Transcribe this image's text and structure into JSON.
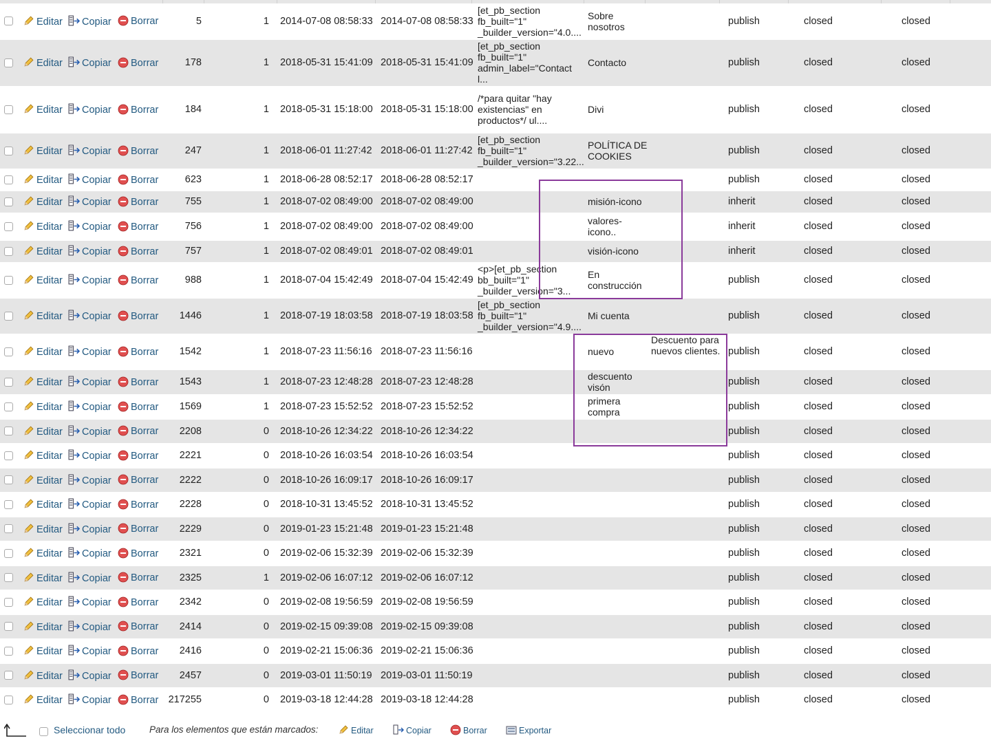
{
  "actions": {
    "edit": "Editar",
    "copy": "Copiar",
    "delete": "Borrar"
  },
  "rows": [
    {
      "id": "5",
      "author": "1",
      "date": "2014-07-08 08:58:33",
      "date_gmt": "2014-07-08 08:58:33",
      "content": "[et_pb_section fb_built=\"1\" _builder_version=\"4.0....",
      "title": "Sobre nosotros",
      "excerpt": "",
      "status": "publish",
      "comment_status": "closed",
      "ping_status": "closed"
    },
    {
      "id": "178",
      "author": "1",
      "date": "2018-05-31 15:41:09",
      "date_gmt": "2018-05-31 15:41:09",
      "content": "[et_pb_section fb_built=\"1\" admin_label=\"Contact l...",
      "title": "Contacto",
      "excerpt": "",
      "status": "publish",
      "comment_status": "closed",
      "ping_status": "closed"
    },
    {
      "id": "184",
      "author": "1",
      "date": "2018-05-31 15:18:00",
      "date_gmt": "2018-05-31 15:18:00",
      "content": "/*para quitar \"hay existencias\" en productos*/ ul....",
      "title": "Divi",
      "excerpt": "",
      "status": "publish",
      "comment_status": "closed",
      "ping_status": "closed"
    },
    {
      "id": "247",
      "author": "1",
      "date": "2018-06-01 11:27:42",
      "date_gmt": "2018-06-01 11:27:42",
      "content": "[et_pb_section fb_built=\"1\" _builder_version=\"3.22...",
      "title": "POLÍTICA DE COOKIES",
      "excerpt": "",
      "status": "publish",
      "comment_status": "closed",
      "ping_status": "closed"
    },
    {
      "id": "623",
      "author": "1",
      "date": "2018-06-28 08:52:17",
      "date_gmt": "2018-06-28 08:52:17",
      "content": "",
      "title": "",
      "excerpt": "",
      "status": "publish",
      "comment_status": "closed",
      "ping_status": "closed"
    },
    {
      "id": "755",
      "author": "1",
      "date": "2018-07-02 08:49:00",
      "date_gmt": "2018-07-02 08:49:00",
      "content": "",
      "title": "misión-icono",
      "excerpt": "",
      "status": "inherit",
      "comment_status": "closed",
      "ping_status": "closed"
    },
    {
      "id": "756",
      "author": "1",
      "date": "2018-07-02 08:49:00",
      "date_gmt": "2018-07-02 08:49:00",
      "content": "",
      "title": "valores-icono..",
      "excerpt": "",
      "status": "inherit",
      "comment_status": "closed",
      "ping_status": "closed"
    },
    {
      "id": "757",
      "author": "1",
      "date": "2018-07-02 08:49:01",
      "date_gmt": "2018-07-02 08:49:01",
      "content": "",
      "title": "visión-icono",
      "excerpt": "",
      "status": "inherit",
      "comment_status": "closed",
      "ping_status": "closed"
    },
    {
      "id": "988",
      "author": "1",
      "date": "2018-07-04 15:42:49",
      "date_gmt": "2018-07-04 15:42:49",
      "content": "<p>[et_pb_section bb_built=\"1\" _builder_version=\"3...",
      "title": "En construcción",
      "excerpt": "",
      "status": "publish",
      "comment_status": "closed",
      "ping_status": "closed"
    },
    {
      "id": "1446",
      "author": "1",
      "date": "2018-07-19 18:03:58",
      "date_gmt": "2018-07-19 18:03:58",
      "content": "[et_pb_section fb_built=\"1\" _builder_version=\"4.9....",
      "title": "Mi cuenta",
      "excerpt": "",
      "status": "publish",
      "comment_status": "closed",
      "ping_status": "closed"
    },
    {
      "id": "1542",
      "author": "1",
      "date": "2018-07-23 11:56:16",
      "date_gmt": "2018-07-23 11:56:16",
      "content": "",
      "title": "nuevo",
      "excerpt": "Descuento para nuevos clientes.",
      "status": "publish",
      "comment_status": "closed",
      "ping_status": "closed"
    },
    {
      "id": "1543",
      "author": "1",
      "date": "2018-07-23 12:48:28",
      "date_gmt": "2018-07-23 12:48:28",
      "content": "",
      "title": "descuento visón",
      "excerpt": "",
      "status": "publish",
      "comment_status": "closed",
      "ping_status": "closed"
    },
    {
      "id": "1569",
      "author": "1",
      "date": "2018-07-23 15:52:52",
      "date_gmt": "2018-07-23 15:52:52",
      "content": "",
      "title": "primera compra",
      "excerpt": "",
      "status": "publish",
      "comment_status": "closed",
      "ping_status": "closed"
    },
    {
      "id": "2208",
      "author": "0",
      "date": "2018-10-26 12:34:22",
      "date_gmt": "2018-10-26 12:34:22",
      "content": "",
      "title": "",
      "excerpt": "",
      "status": "publish",
      "comment_status": "closed",
      "ping_status": "closed"
    },
    {
      "id": "2221",
      "author": "0",
      "date": "2018-10-26 16:03:54",
      "date_gmt": "2018-10-26 16:03:54",
      "content": "",
      "title": "",
      "excerpt": "",
      "status": "publish",
      "comment_status": "closed",
      "ping_status": "closed"
    },
    {
      "id": "2222",
      "author": "0",
      "date": "2018-10-26 16:09:17",
      "date_gmt": "2018-10-26 16:09:17",
      "content": "",
      "title": "",
      "excerpt": "",
      "status": "publish",
      "comment_status": "closed",
      "ping_status": "closed"
    },
    {
      "id": "2228",
      "author": "0",
      "date": "2018-10-31 13:45:52",
      "date_gmt": "2018-10-31 13:45:52",
      "content": "",
      "title": "",
      "excerpt": "",
      "status": "publish",
      "comment_status": "closed",
      "ping_status": "closed"
    },
    {
      "id": "2229",
      "author": "0",
      "date": "2019-01-23 15:21:48",
      "date_gmt": "2019-01-23 15:21:48",
      "content": "",
      "title": "",
      "excerpt": "",
      "status": "publish",
      "comment_status": "closed",
      "ping_status": "closed"
    },
    {
      "id": "2321",
      "author": "0",
      "date": "2019-02-06 15:32:39",
      "date_gmt": "2019-02-06 15:32:39",
      "content": "",
      "title": "",
      "excerpt": "",
      "status": "publish",
      "comment_status": "closed",
      "ping_status": "closed"
    },
    {
      "id": "2325",
      "author": "1",
      "date": "2019-02-06 16:07:12",
      "date_gmt": "2019-02-06 16:07:12",
      "content": "",
      "title": "",
      "excerpt": "",
      "status": "publish",
      "comment_status": "closed",
      "ping_status": "closed"
    },
    {
      "id": "2342",
      "author": "0",
      "date": "2019-02-08 19:56:59",
      "date_gmt": "2019-02-08 19:56:59",
      "content": "",
      "title": "",
      "excerpt": "",
      "status": "publish",
      "comment_status": "closed",
      "ping_status": "closed"
    },
    {
      "id": "2414",
      "author": "0",
      "date": "2019-02-15 09:39:08",
      "date_gmt": "2019-02-15 09:39:08",
      "content": "",
      "title": "",
      "excerpt": "",
      "status": "publish",
      "comment_status": "closed",
      "ping_status": "closed"
    },
    {
      "id": "2416",
      "author": "0",
      "date": "2019-02-21 15:06:36",
      "date_gmt": "2019-02-21 15:06:36",
      "content": "",
      "title": "",
      "excerpt": "",
      "status": "publish",
      "comment_status": "closed",
      "ping_status": "closed"
    },
    {
      "id": "2457",
      "author": "0",
      "date": "2019-03-01 11:50:19",
      "date_gmt": "2019-03-01 11:50:19",
      "content": "",
      "title": "",
      "excerpt": "",
      "status": "publish",
      "comment_status": "closed",
      "ping_status": "closed"
    },
    {
      "id": "217255",
      "author": "0",
      "date": "2019-03-18 12:44:28",
      "date_gmt": "2019-03-18 12:44:28",
      "content": "",
      "title": "",
      "excerpt": "",
      "status": "publish",
      "comment_status": "closed",
      "ping_status": "closed"
    }
  ],
  "footer": {
    "select_all": "Seleccionar todo",
    "with_selected": "Para los elementos que están marcados:",
    "edit": "Editar",
    "copy": "Copiar",
    "delete": "Borrar",
    "export": "Exportar"
  },
  "colors": {
    "link": "#235a81",
    "row_alt": "#e5e5e5",
    "annotation": "#8a3a9a"
  },
  "icons": [
    "pencil-icon",
    "copy-icon",
    "delete-icon",
    "export-icon",
    "arrow-up-left-icon"
  ]
}
